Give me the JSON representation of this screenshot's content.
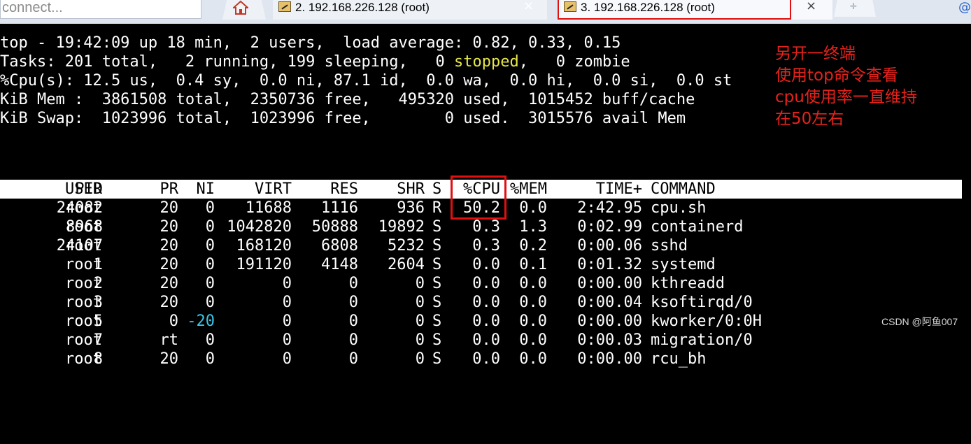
{
  "tabbar": {
    "connect_placeholder": " connect...",
    "tabs": [
      {
        "label": "2. 192.168.226.128 (root)"
      },
      {
        "label": "3. 192.168.226.128 (root)"
      }
    ],
    "close_symbol": "×"
  },
  "terminal": {
    "summary": {
      "line1": "top - 19:42:09 up 18 min,  2 users,  load average: 0.82, 0.33, 0.15",
      "line2_a": "Tasks: 201 total,   2 running, 199 sleeping,   0 ",
      "line2_stopped": "stopped",
      "line2_b": ",   0 zombie",
      "line3": "%Cpu(s): 12.5 us,  0.4 sy,  0.0 ni, 87.1 id,  0.0 wa,  0.0 hi,  0.0 si,  0.0 st",
      "line4": "KiB Mem :  3861508 total,  2350736 free,   495320 used,  1015452 buff/cache",
      "line5": "KiB Swap:  1023996 total,  1023996 free,        0 used.  3015576 avail Mem"
    },
    "columns": [
      "PID",
      "USER",
      "PR",
      "NI",
      "VIRT",
      "RES",
      "SHR",
      "S",
      "%CPU",
      "%MEM",
      "TIME+",
      "COMMAND"
    ],
    "processes": [
      {
        "pid": "24082",
        "user": "root",
        "pr": "20",
        "ni": "0",
        "virt": "11688",
        "res": "1116",
        "shr": "936",
        "s": "R",
        "cpu": "50.2",
        "mem": "0.0",
        "time": "2:42.95",
        "command": "cpu.sh"
      },
      {
        "pid": "8968",
        "user": "root",
        "pr": "20",
        "ni": "0",
        "virt": "1042820",
        "res": "50888",
        "shr": "19892",
        "s": "S",
        "cpu": "0.3",
        "mem": "1.3",
        "time": "0:02.99",
        "command": "containerd"
      },
      {
        "pid": "24107",
        "user": "root",
        "pr": "20",
        "ni": "0",
        "virt": "168120",
        "res": "6808",
        "shr": "5232",
        "s": "S",
        "cpu": "0.3",
        "mem": "0.2",
        "time": "0:00.06",
        "command": "sshd"
      },
      {
        "pid": "1",
        "user": "root",
        "pr": "20",
        "ni": "0",
        "virt": "191120",
        "res": "4148",
        "shr": "2604",
        "s": "S",
        "cpu": "0.0",
        "mem": "0.1",
        "time": "0:01.32",
        "command": "systemd"
      },
      {
        "pid": "2",
        "user": "root",
        "pr": "20",
        "ni": "0",
        "virt": "0",
        "res": "0",
        "shr": "0",
        "s": "S",
        "cpu": "0.0",
        "mem": "0.0",
        "time": "0:00.00",
        "command": "kthreadd"
      },
      {
        "pid": "3",
        "user": "root",
        "pr": "20",
        "ni": "0",
        "virt": "0",
        "res": "0",
        "shr": "0",
        "s": "S",
        "cpu": "0.0",
        "mem": "0.0",
        "time": "0:00.04",
        "command": "ksoftirqd/0"
      },
      {
        "pid": "5",
        "user": "root",
        "pr": "0",
        "ni": "-20",
        "virt": "0",
        "res": "0",
        "shr": "0",
        "s": "S",
        "cpu": "0.0",
        "mem": "0.0",
        "time": "0:00.00",
        "command": "kworker/0:0H"
      },
      {
        "pid": "7",
        "user": "root",
        "pr": "rt",
        "ni": "0",
        "virt": "0",
        "res": "0",
        "shr": "0",
        "s": "S",
        "cpu": "0.0",
        "mem": "0.0",
        "time": "0:00.03",
        "command": "migration/0"
      },
      {
        "pid": "8",
        "user": "root",
        "pr": "20",
        "ni": "0",
        "virt": "0",
        "res": "0",
        "shr": "0",
        "s": "S",
        "cpu": "0.0",
        "mem": "0.0",
        "time": "0:00.00",
        "command": "rcu_bh"
      }
    ]
  },
  "annotation": {
    "lines": [
      "另开一终端",
      "使用top命令查看",
      "cpu使用率一直维持",
      "在50左右"
    ]
  },
  "watermark": "CSDN @阿鱼007",
  "colors": {
    "highlight_red": "#e01010",
    "note_red": "#e8221c",
    "stopped_yellow": "#e8e84a",
    "negative_nice_cyan": "#3ac6e6"
  }
}
